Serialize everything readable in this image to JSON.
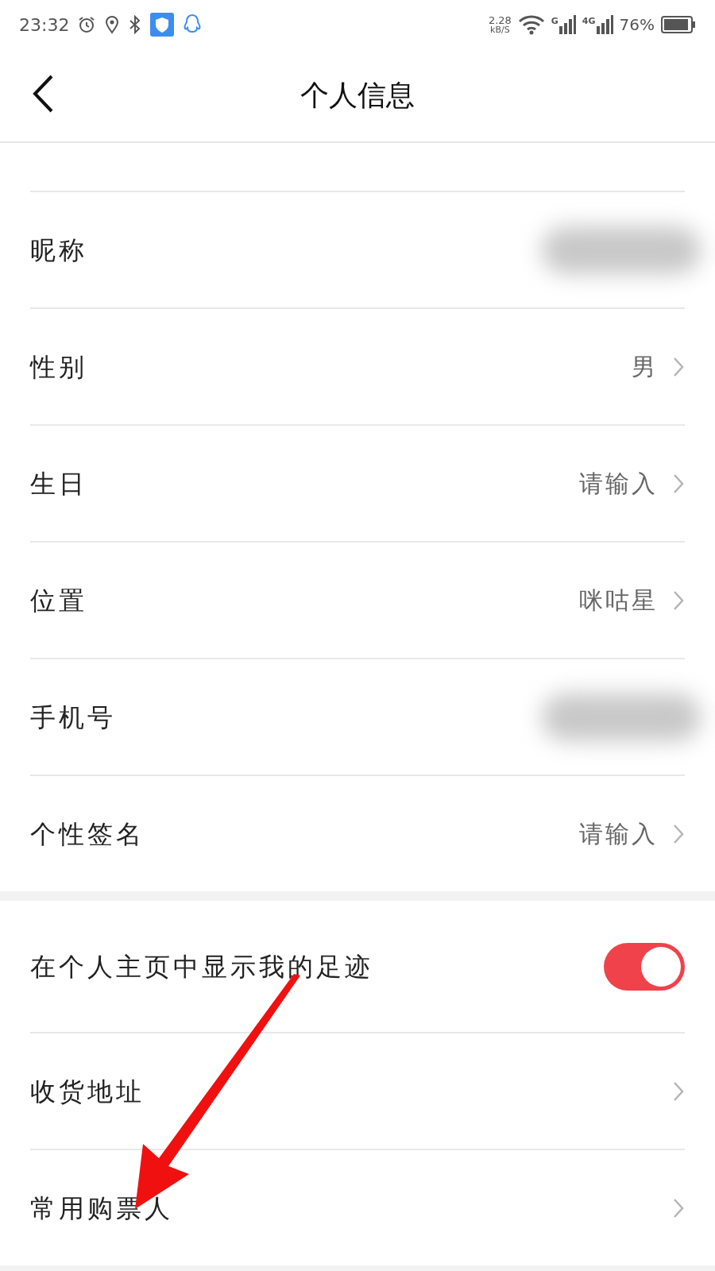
{
  "status_bar": {
    "time": "23:32",
    "speed": "2.28",
    "speed_unit": "kB/S",
    "network_1": "G",
    "network_2": "4G",
    "battery": "76%"
  },
  "header": {
    "title": "个人信息"
  },
  "sections": [
    {
      "rows": [
        {
          "kind": "blurred",
          "label": "昵称"
        },
        {
          "kind": "value",
          "label": "性别",
          "value": "男"
        },
        {
          "kind": "value",
          "label": "生日",
          "value": "请输入"
        },
        {
          "kind": "value",
          "label": "位置",
          "value": "咪咕星"
        },
        {
          "kind": "blurred",
          "label": "手机号"
        },
        {
          "kind": "value",
          "label": "个性签名",
          "value": "请输入"
        }
      ]
    },
    {
      "rows": [
        {
          "kind": "toggle",
          "label": "在个人主页中显示我的足迹",
          "on": true
        },
        {
          "kind": "link",
          "label": "收货地址"
        },
        {
          "kind": "link",
          "label": "常用购票人"
        }
      ]
    }
  ]
}
